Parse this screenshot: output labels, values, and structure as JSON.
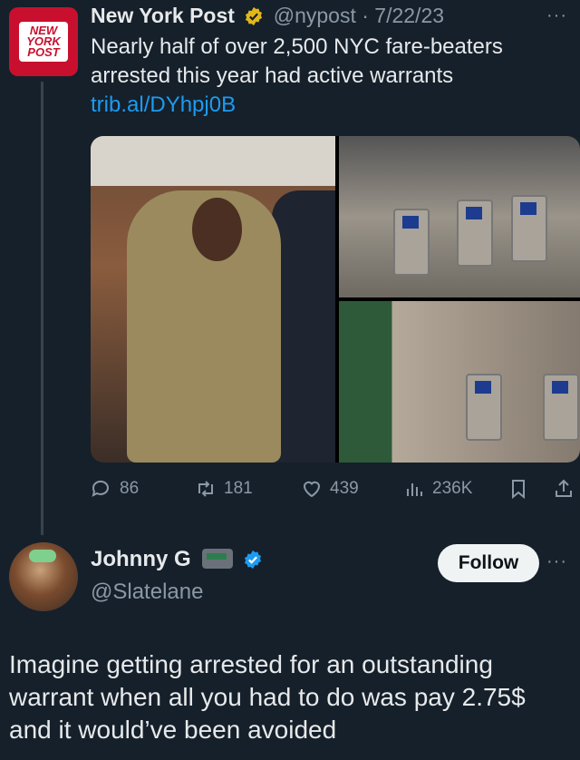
{
  "tweet": {
    "avatar_logo": "NEW YORK POST",
    "name": "New York Post",
    "handle": "@nypost",
    "separator": "·",
    "date": "7/22/23",
    "more": "···",
    "text": "Nearly half of over 2,500 NYC fare-beaters arrested this year had active warrants ",
    "link_text": "trib.al/DYhpj0B",
    "media_icons": [
      "photo-arrest",
      "photo-turnstiles",
      "photo-fare-evader"
    ],
    "actions": {
      "replies": "86",
      "retweets": "181",
      "likes": "439",
      "views": "236K"
    }
  },
  "reply": {
    "name": "Johnny G",
    "handle": "@Slatelane",
    "follow_label": "Follow",
    "more": "···",
    "text": "Imagine getting arrested for an outstanding warrant when all you had to do was pay 2.75$ and it would’ve been avoided"
  },
  "colors": {
    "background": "#15202b",
    "accent": "#1d9bf0",
    "muted": "#8b98a5",
    "brand_red": "#c8102e"
  }
}
